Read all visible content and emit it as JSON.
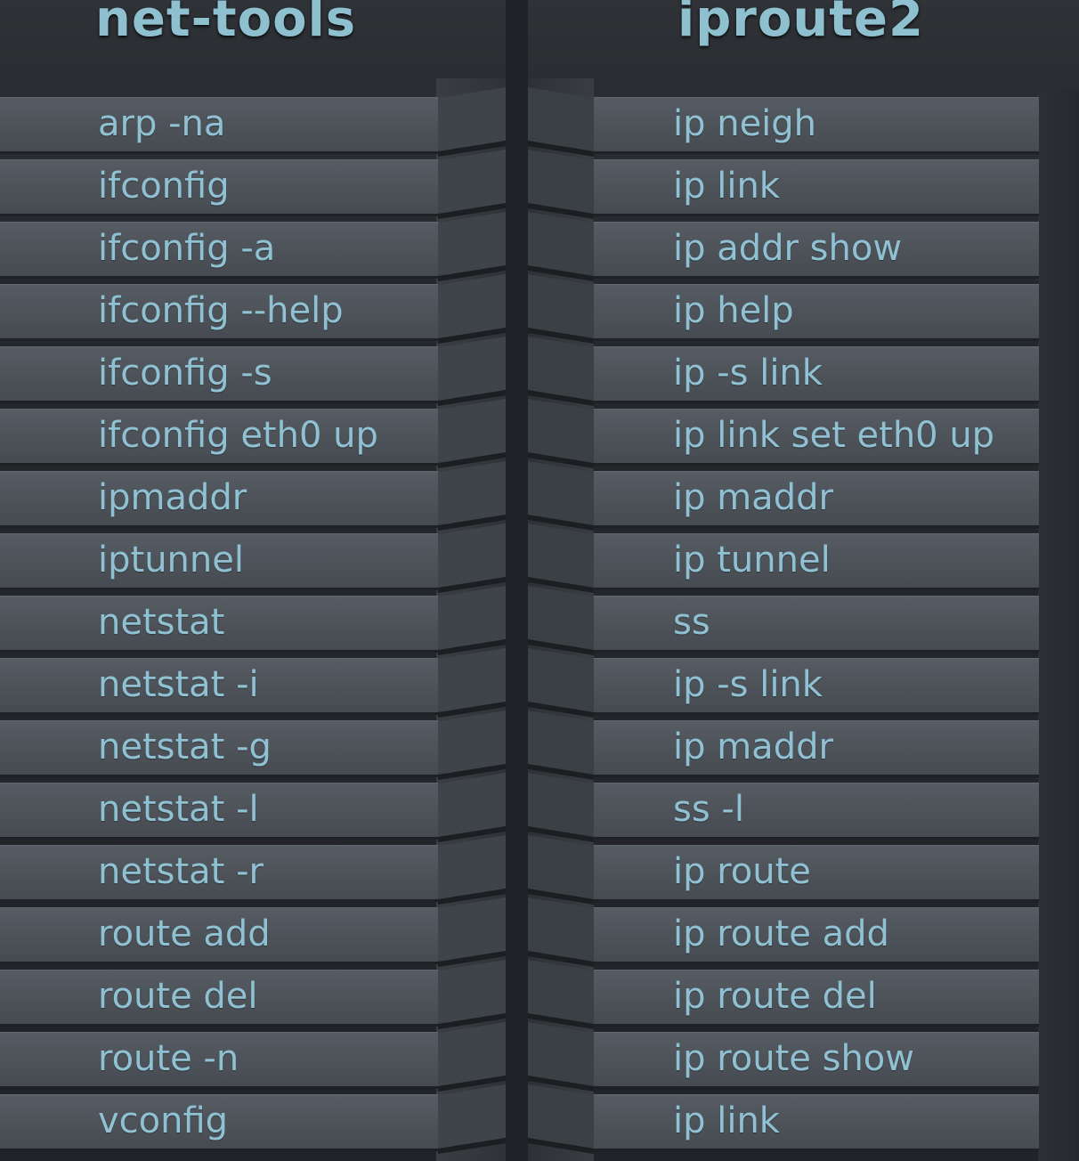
{
  "headings": {
    "left": "net-tools",
    "right": "iproute2"
  },
  "colors": {
    "text": "#8fc1d2",
    "row_face": "#4f555c",
    "background": "#25282c"
  },
  "rows": [
    {
      "net_tools": "arp -na",
      "iproute2": "ip neigh"
    },
    {
      "net_tools": "ifconfig",
      "iproute2": "ip link"
    },
    {
      "net_tools": "ifconfig -a",
      "iproute2": "ip addr show"
    },
    {
      "net_tools": "ifconfig --help",
      "iproute2": "ip help"
    },
    {
      "net_tools": "ifconfig -s",
      "iproute2": "ip -s link"
    },
    {
      "net_tools": "ifconfig eth0 up",
      "iproute2": "ip link set eth0 up"
    },
    {
      "net_tools": "ipmaddr",
      "iproute2": "ip maddr"
    },
    {
      "net_tools": "iptunnel",
      "iproute2": "ip tunnel"
    },
    {
      "net_tools": "netstat",
      "iproute2": "ss"
    },
    {
      "net_tools": "netstat -i",
      "iproute2": "ip -s link"
    },
    {
      "net_tools": "netstat  -g",
      "iproute2": "ip maddr"
    },
    {
      "net_tools": "netstat -l",
      "iproute2": "ss -l"
    },
    {
      "net_tools": "netstat -r",
      "iproute2": "ip route"
    },
    {
      "net_tools": "route add",
      "iproute2": "ip route add"
    },
    {
      "net_tools": "route del",
      "iproute2": "ip route del"
    },
    {
      "net_tools": "route -n",
      "iproute2": "ip route show"
    },
    {
      "net_tools": "vconfig",
      "iproute2": "ip link"
    }
  ]
}
